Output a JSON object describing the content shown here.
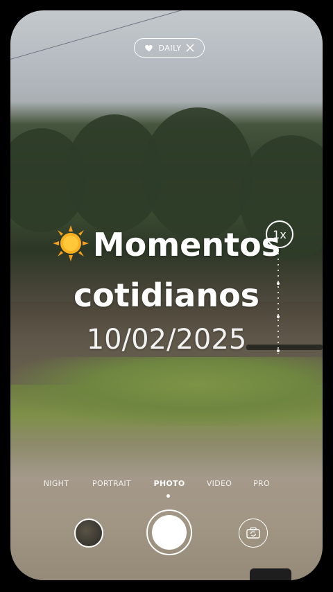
{
  "badge": {
    "label": "DAILY"
  },
  "title": {
    "line1": "Momentos",
    "line2": "cotidianos"
  },
  "date": "10/02/2025",
  "zoom": {
    "label": "1x"
  },
  "modes": [
    {
      "label": "NIGHT"
    },
    {
      "label": "PORTRAIT"
    },
    {
      "label": "PHOTO"
    },
    {
      "label": "VIDEO"
    },
    {
      "label": "PRO"
    }
  ],
  "active_mode": "PHOTO",
  "colors": {
    "text": "#ffffff",
    "frame": "#000000"
  },
  "icons": [
    "heart-icon",
    "close-icon",
    "sun-emoji-icon",
    "camera-switch-icon"
  ]
}
